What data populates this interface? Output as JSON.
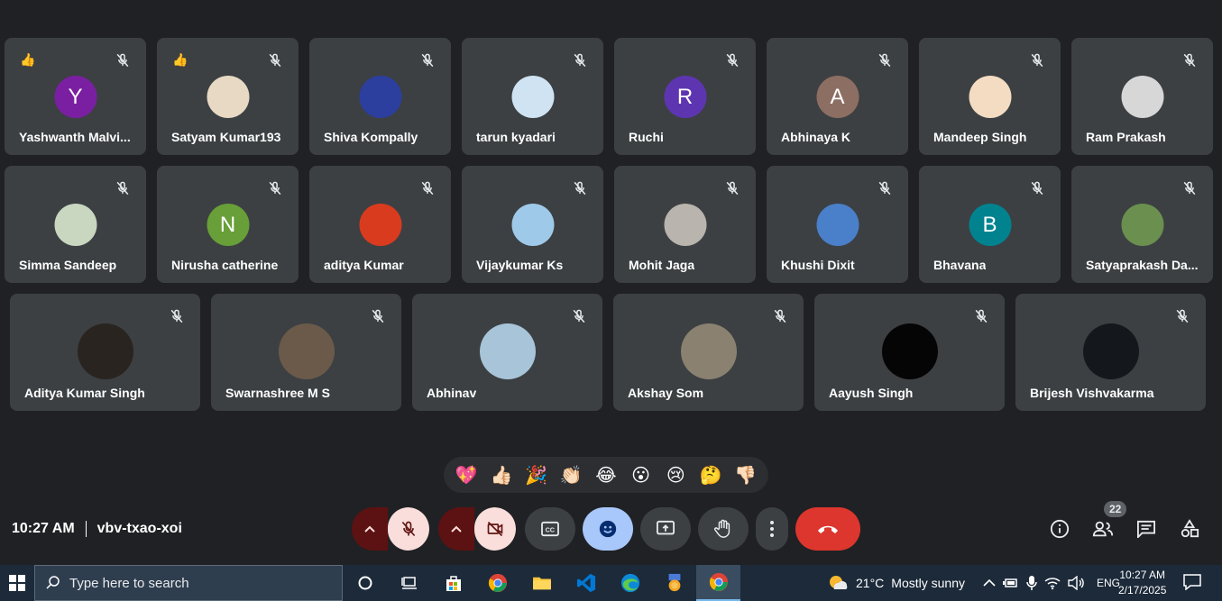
{
  "participants_row1": [
    {
      "name": "Yashwanth Malvi...",
      "avatar_letter": "Y",
      "avatar_color": "#7b1fa2",
      "hand": true
    },
    {
      "name": "Satyam Kumar193",
      "avatar_letter": "",
      "avatar_color": "#e8d9c4",
      "hand": true
    },
    {
      "name": "Shiva Kompally",
      "avatar_letter": "",
      "avatar_color": "#2c3e9e",
      "hand": false
    },
    {
      "name": "tarun kyadari",
      "avatar_letter": "",
      "avatar_color": "#cfe3f2",
      "hand": false
    },
    {
      "name": "Ruchi",
      "avatar_letter": "R",
      "avatar_color": "#5e35b1",
      "hand": false
    },
    {
      "name": "Abhinaya K",
      "avatar_letter": "A",
      "avatar_color": "#8d6e63",
      "hand": false
    },
    {
      "name": "Mandeep Singh",
      "avatar_letter": "",
      "avatar_color": "#f3dcc2",
      "hand": false
    },
    {
      "name": "Ram Prakash",
      "avatar_letter": "",
      "avatar_color": "#d7d7d7",
      "hand": false
    }
  ],
  "participants_row2": [
    {
      "name": "Simma Sandeep",
      "avatar_letter": "",
      "avatar_color": "#c9d6c0"
    },
    {
      "name": "Nirusha catherine",
      "avatar_letter": "N",
      "avatar_color": "#689f38"
    },
    {
      "name": "aditya Kumar",
      "avatar_letter": "",
      "avatar_color": "#d93b1f"
    },
    {
      "name": "Vijaykumar Ks",
      "avatar_letter": "",
      "avatar_color": "#9fc9e8"
    },
    {
      "name": "Mohit Jaga",
      "avatar_letter": "",
      "avatar_color": "#b9b4ad"
    },
    {
      "name": "Khushi Dixit",
      "avatar_letter": "",
      "avatar_color": "#4a7fc9"
    },
    {
      "name": "Bhavana",
      "avatar_letter": "B",
      "avatar_color": "#00838f"
    },
    {
      "name": "Satyaprakash Da...",
      "avatar_letter": "",
      "avatar_color": "#6a8f4f"
    }
  ],
  "participants_row3": [
    {
      "name": "Aditya Kumar Singh",
      "avatar_color": "#2a2420"
    },
    {
      "name": "Swarnashree M S",
      "avatar_color": "#6b5a4a"
    },
    {
      "name": "Abhinav",
      "avatar_color": "#a8c4d8"
    },
    {
      "name": "Akshay Som",
      "avatar_color": "#8a8170"
    },
    {
      "name": "Aayush Singh",
      "avatar_color": "#050505"
    },
    {
      "name": "Brijesh Vishvakarma",
      "avatar_color": "#14181c"
    }
  ],
  "reactions": [
    "💖",
    "👍🏻",
    "🎉",
    "👏🏻",
    "😂",
    "😮",
    "😢",
    "🤔",
    "👎🏻"
  ],
  "meeting": {
    "time": "10:27 AM",
    "code": "vbv-txao-xoi",
    "participant_count": "22"
  },
  "taskbar": {
    "search_placeholder": "Type here to search",
    "weather_temp": "21°C",
    "weather_text": "Mostly sunny",
    "language": "ENG",
    "clock_time": "10:27 AM",
    "clock_date": "2/17/2025"
  },
  "colors": {
    "end_call": "#dc362e",
    "emoji_active": "#a8c7fa",
    "mic_cam_off_bg": "#f9dedc",
    "caret_bg": "#5c1212"
  }
}
